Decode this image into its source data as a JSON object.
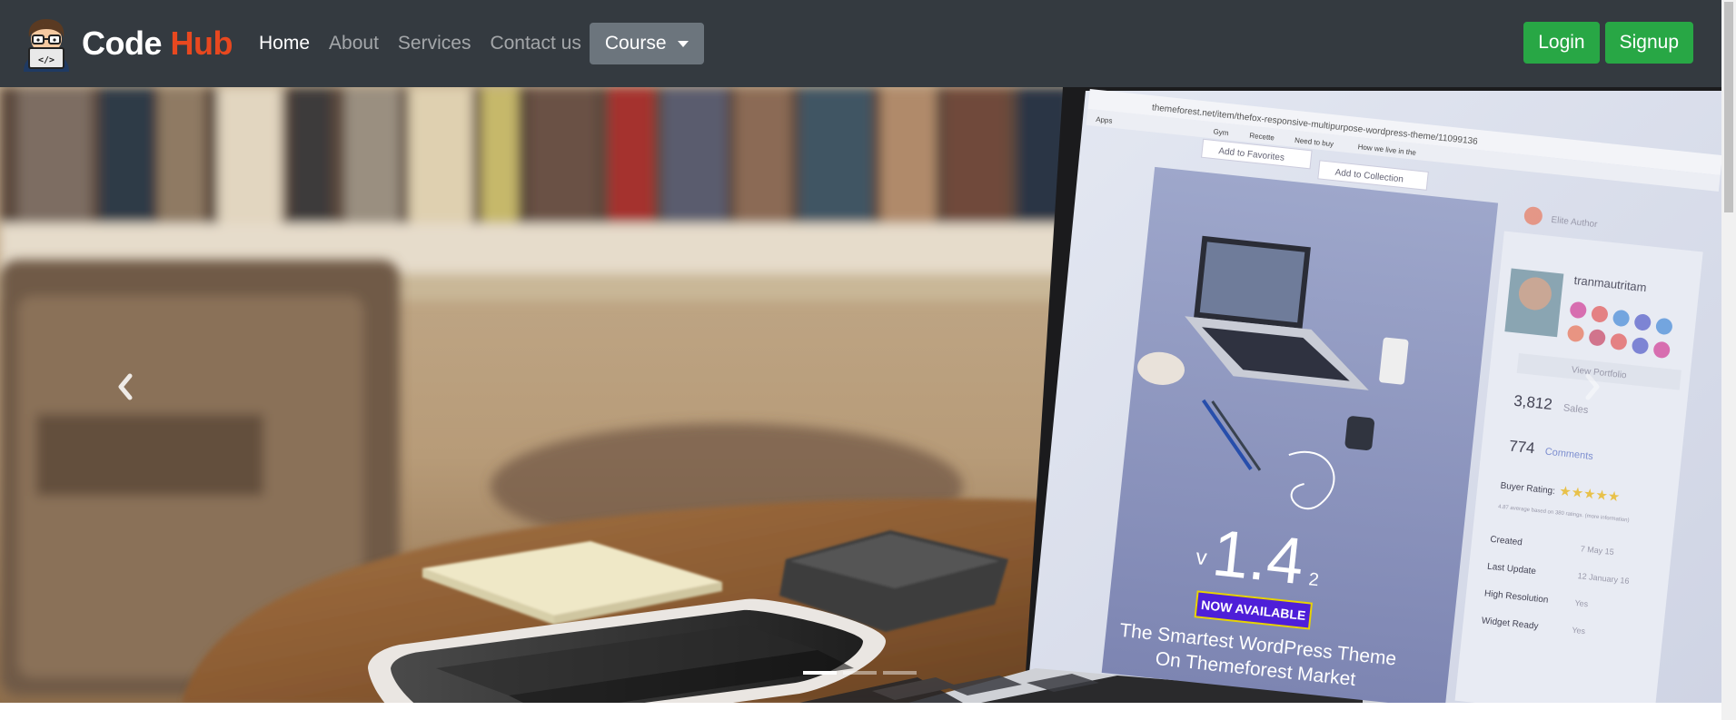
{
  "brand": {
    "name_part1": "Code",
    "name_part2": "Hub",
    "accent_color": "#e8481f",
    "logo_icon": "programmer-avatar-icon"
  },
  "nav": {
    "items": [
      {
        "label": "Home",
        "active": true
      },
      {
        "label": "About",
        "active": false
      },
      {
        "label": "Services",
        "active": false
      },
      {
        "label": "Contact us",
        "active": false
      }
    ],
    "dropdown_label": "Course"
  },
  "auth": {
    "login_label": "Login",
    "signup_label": "Signup",
    "button_color": "#28a745"
  },
  "carousel": {
    "active_slide": 1,
    "slide_count": 3,
    "prev_icon": "chevron-left-icon",
    "next_icon": "chevron-right-icon",
    "screen": {
      "url": "themeforest.net/item/thefox-responsive-multipurpose-wordpress-theme/11099136",
      "bookmark_apps": "Apps",
      "bookmark_gym": "Gym",
      "bookmark_recette": "Recette",
      "bookmark_needtobuy": "Need to buy",
      "bookmark_howwelive": "How we live in the",
      "add_favorites": "Add to Favorites",
      "add_collection": "Add to Collection",
      "elite_author": "Elite Author",
      "author_name": "tranmautritam",
      "view_portfolio": "View Portfolio",
      "sales_count": "3,812",
      "sales_label": "Sales",
      "comments_count": "774",
      "comments_label": "Comments",
      "buyer_rating": "Buyer Rating:",
      "rating_stars": "★★★★★",
      "rating_note": "4.87 average based on 380 ratings. (more information)",
      "version_v": "v",
      "version_major": "1.4",
      "version_minor": "2",
      "badge": "NOW AVAILABLE",
      "tagline_1": "The Smartest WordPress Theme",
      "tagline_2": "On Themeforest Market",
      "meta_created": "Created",
      "meta_created_val": "7 May 15",
      "meta_update": "Last Update",
      "meta_update_val": "12 January 16",
      "meta_highres": "High Resolution",
      "meta_highres_val": "Yes",
      "meta_widget": "Widget Ready",
      "meta_widget_val": "Yes"
    }
  }
}
